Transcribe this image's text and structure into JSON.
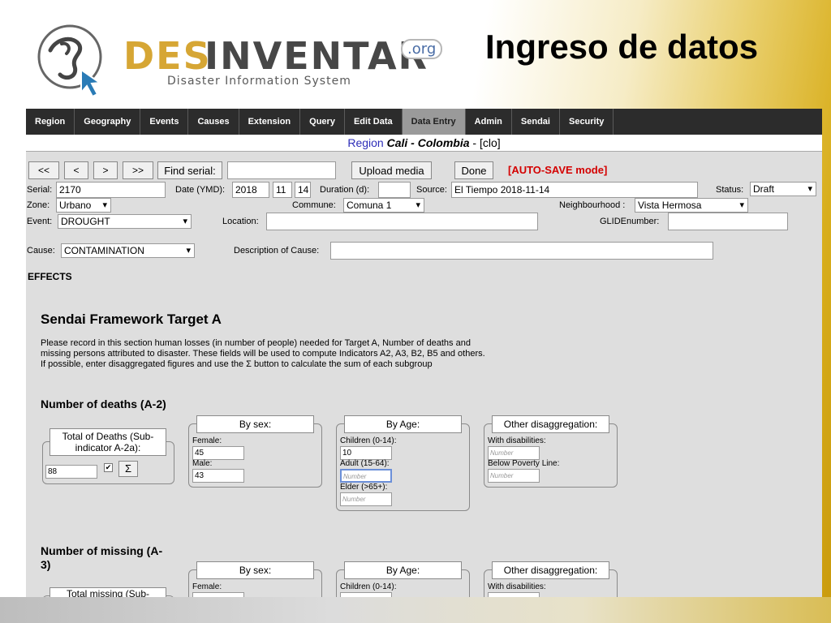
{
  "header": {
    "logo_des": "DES",
    "logo_inventar": "INVENTAR",
    "logo_org": ".org",
    "logo_subtitle": "Disaster Information System",
    "page_title": "Ingreso de datos"
  },
  "nav": {
    "items": [
      "Region",
      "Geography",
      "Events",
      "Causes",
      "Extension",
      "Query",
      "Edit Data",
      "Data Entry",
      "Admin",
      "Sendai",
      "Security"
    ],
    "active": "Data Entry"
  },
  "region": {
    "prefix": "Region ",
    "name": "Cali - Colombia",
    "code": " - [clo]"
  },
  "toolbar": {
    "first": "<<",
    "prev": "<",
    "next": ">",
    "last": ">>",
    "find_serial": "Find serial:",
    "find_serial_value": "",
    "upload": "Upload media",
    "done": "Done",
    "autosave": "[AUTO-SAVE mode]"
  },
  "form": {
    "serial_label": "Serial:",
    "serial": "2170",
    "date_label": "Date (YMD):",
    "year": "2018",
    "month": "11",
    "day": "14",
    "duration_label": "Duration (d):",
    "duration": "",
    "source_label": "Source:",
    "source": "El Tiempo 2018-11-14",
    "status_label": "Status:",
    "status": "Draft",
    "zone_label": "Zone:",
    "zone": "Urbano",
    "commune_label": "Commune:",
    "commune": "Comuna 1",
    "neighbourhood_label": "Neighbourhood :",
    "neighbourhood": "Vista Hermosa",
    "event_label": "Event:",
    "event": "DROUGHT",
    "location_label": "Location:",
    "location": "",
    "glide_label": "GLIDEnumber:",
    "glide": "",
    "cause_label": "Cause:",
    "cause": "CONTAMINATION",
    "cause_desc_label": "Description of Cause:",
    "cause_desc": ""
  },
  "effects": {
    "heading": "EFFECTS",
    "sendai_title": "Sendai Framework Target A",
    "description": [
      "Please record in this section human losses (in number of people) needed for Target A, Number of deaths and",
      "missing persons attributed to disaster. These fields will be used to compute Indicators A2, A3, B2, B5 and others.",
      "If possible, enter disaggregated figures and use the Σ button to calculate the sum of each subgroup"
    ],
    "deaths": {
      "title": "Number of deaths (A-2)",
      "total_label": "Total of Deaths (Sub-indicator A-2a):",
      "total": "88",
      "sum_button": "Σ",
      "checked": true,
      "by_sex": {
        "title": "By sex:",
        "female_label": "Female:",
        "female": "45",
        "male_label": "Male:",
        "male": "43"
      },
      "by_age": {
        "title": "By Age:",
        "children_label": "Children (0-14):",
        "children": "10",
        "adult_label": "Adult (15-64):",
        "adult_placeholder": "Number",
        "elder_label": "Elder (>65+):",
        "elder_placeholder": "Number"
      },
      "other": {
        "title": "Other disaggregation:",
        "disab_label": "With disabilities:",
        "disab_placeholder": "Number",
        "poverty_label": "Below Poverty Line:",
        "poverty_placeholder": "Number"
      }
    },
    "missing": {
      "title": "Number of missing (A-3)",
      "total_label": "Total missing (Sub-",
      "by_sex": {
        "title": "By sex:",
        "female_label": "Female:"
      },
      "by_age": {
        "title": "By Age:",
        "children_label": "Children (0-14):"
      },
      "other": {
        "title": "Other disaggregation:",
        "disab_label": "With disabilities:"
      }
    }
  },
  "colors": {
    "accent_gold": "#d6a634",
    "nav_bg": "#2c2c2c",
    "autosave_red": "#d40000",
    "region_blue": "#2d2db8"
  }
}
